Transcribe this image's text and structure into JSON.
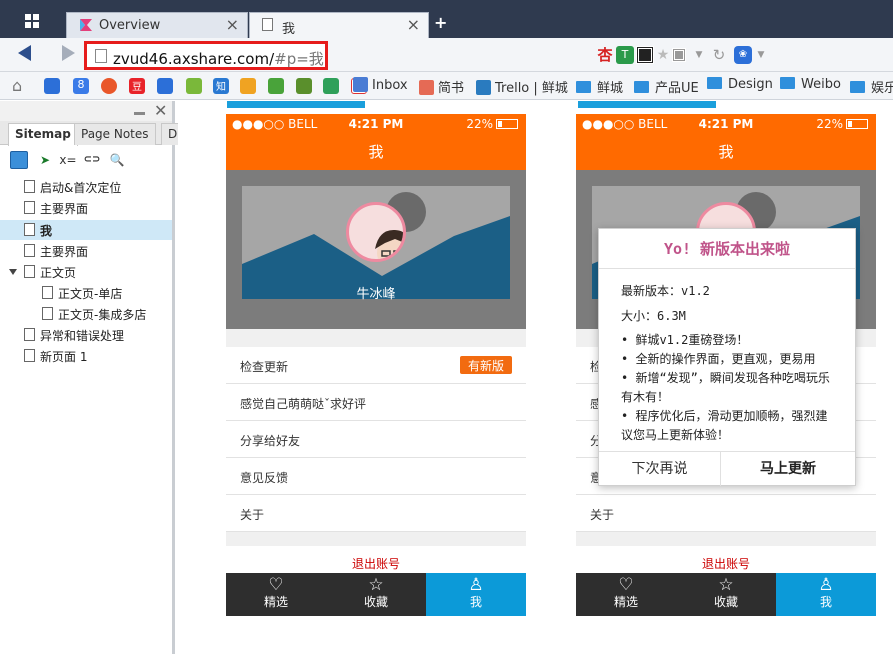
{
  "browser": {
    "tabs": [
      {
        "title": "Overview",
        "close": "×"
      },
      {
        "title": "我",
        "close": "×"
      }
    ],
    "new_tab": "+",
    "url": {
      "host": "zvud46.axshare.com/",
      "path": "#p=我"
    },
    "bookmarks": [
      {
        "label": "Inbox"
      },
      {
        "label": "简书"
      },
      {
        "label": "Trello | 鲜城"
      },
      {
        "label": "鲜城"
      },
      {
        "label": "产品UE"
      },
      {
        "label": "Design"
      },
      {
        "label": "Weibo"
      },
      {
        "label": "娱乐"
      }
    ]
  },
  "sidebar": {
    "tabs": [
      "Sitemap",
      "Page Notes",
      "D"
    ],
    "close": "✕",
    "tools": {
      "filter": "x=",
      "link": "⊂⊃",
      "search": "🔍"
    },
    "pages": [
      {
        "label": "启动&首次定位"
      },
      {
        "label": "主要界面"
      },
      {
        "label": "我"
      },
      {
        "label": "主要界面"
      },
      {
        "label": "正文页"
      },
      {
        "label": "正文页-单店"
      },
      {
        "label": "正文页-集成多店"
      },
      {
        "label": "异常和错误处理"
      },
      {
        "label": "新页面 1"
      }
    ]
  },
  "phone": {
    "status": {
      "carrier": "●●●○○ BELL",
      "time": "4:21 PM",
      "battery": "22%"
    },
    "title": "我",
    "username": "牛冰峰",
    "menu": [
      {
        "label": "检查更新",
        "badge": "有新版"
      },
      {
        "label": "感觉自己萌萌哒ˇ求好评"
      },
      {
        "label": "分享给好友"
      },
      {
        "label": "意见反馈"
      },
      {
        "label": "关于"
      }
    ],
    "logout": "退出账号",
    "tabs": [
      {
        "label": "精选",
        "icon": "heart-icon"
      },
      {
        "label": "收藏",
        "icon": "star-icon"
      },
      {
        "label": "我",
        "icon": "person-icon"
      }
    ]
  },
  "dialog": {
    "title": "Yo! 新版本出来啦",
    "version": "最新版本：v1.2",
    "size": "大小：6.3M",
    "notes": [
      "• 鲜城v1.2重磅登场！",
      "• 全新的操作界面，更直观，更易用",
      "• 新增“发现”，瞬间发现各种吃喝玩乐有木有！",
      "• 程序优化后，滑动更加顺畅，强烈建议您马上更新体验！"
    ],
    "later": "下次再说",
    "update": "马上更新"
  },
  "colors": {
    "accent": "#ff6a00",
    "active_tab": "#0c9ad8",
    "highlight_border": "#e61c1c",
    "dialog_title": "#c0548a"
  }
}
